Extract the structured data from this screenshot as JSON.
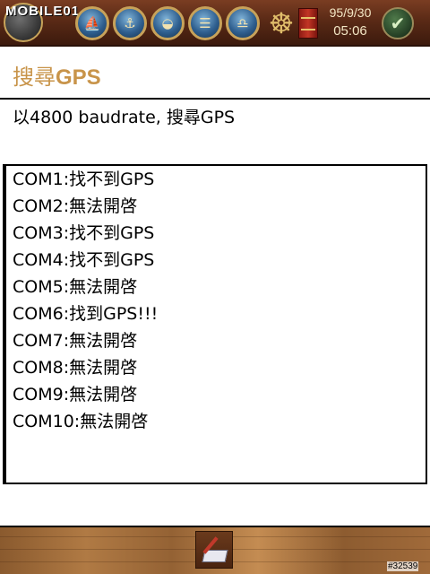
{
  "status_bar": {
    "logo": "MOBILE01",
    "date": "95/9/30",
    "time": "05:06",
    "ok_glyph": "✔",
    "helm_glyph": "☸",
    "app_icons": [
      {
        "name": "ship-icon",
        "glyph": "⛵"
      },
      {
        "name": "ship-icon-2",
        "glyph": "⚓"
      },
      {
        "name": "globe-icon",
        "glyph": "◒"
      },
      {
        "name": "compass-icon",
        "glyph": "☰"
      },
      {
        "name": "bell-icon",
        "glyph": "♎"
      }
    ]
  },
  "page": {
    "title_prefix": "搜尋",
    "title_bold": "GPS",
    "subtitle": "以4800 baudrate, 搜尋GPS"
  },
  "results": [
    "COM1:找不到GPS",
    "COM2:無法開啓",
    "COM3:找不到GPS",
    "COM4:找不到GPS",
    "COM5:無法開啓",
    "COM6:找到GPS!!!",
    "COM7:無法開啓",
    "COM8:無法開啓",
    "COM9:無法開啓",
    "COM10:無法開啓"
  ],
  "watermark": "#32539",
  "colors": {
    "title": "#c8944a",
    "status_bar": "#5a2a16",
    "bottom_bar": "#b07a44"
  }
}
